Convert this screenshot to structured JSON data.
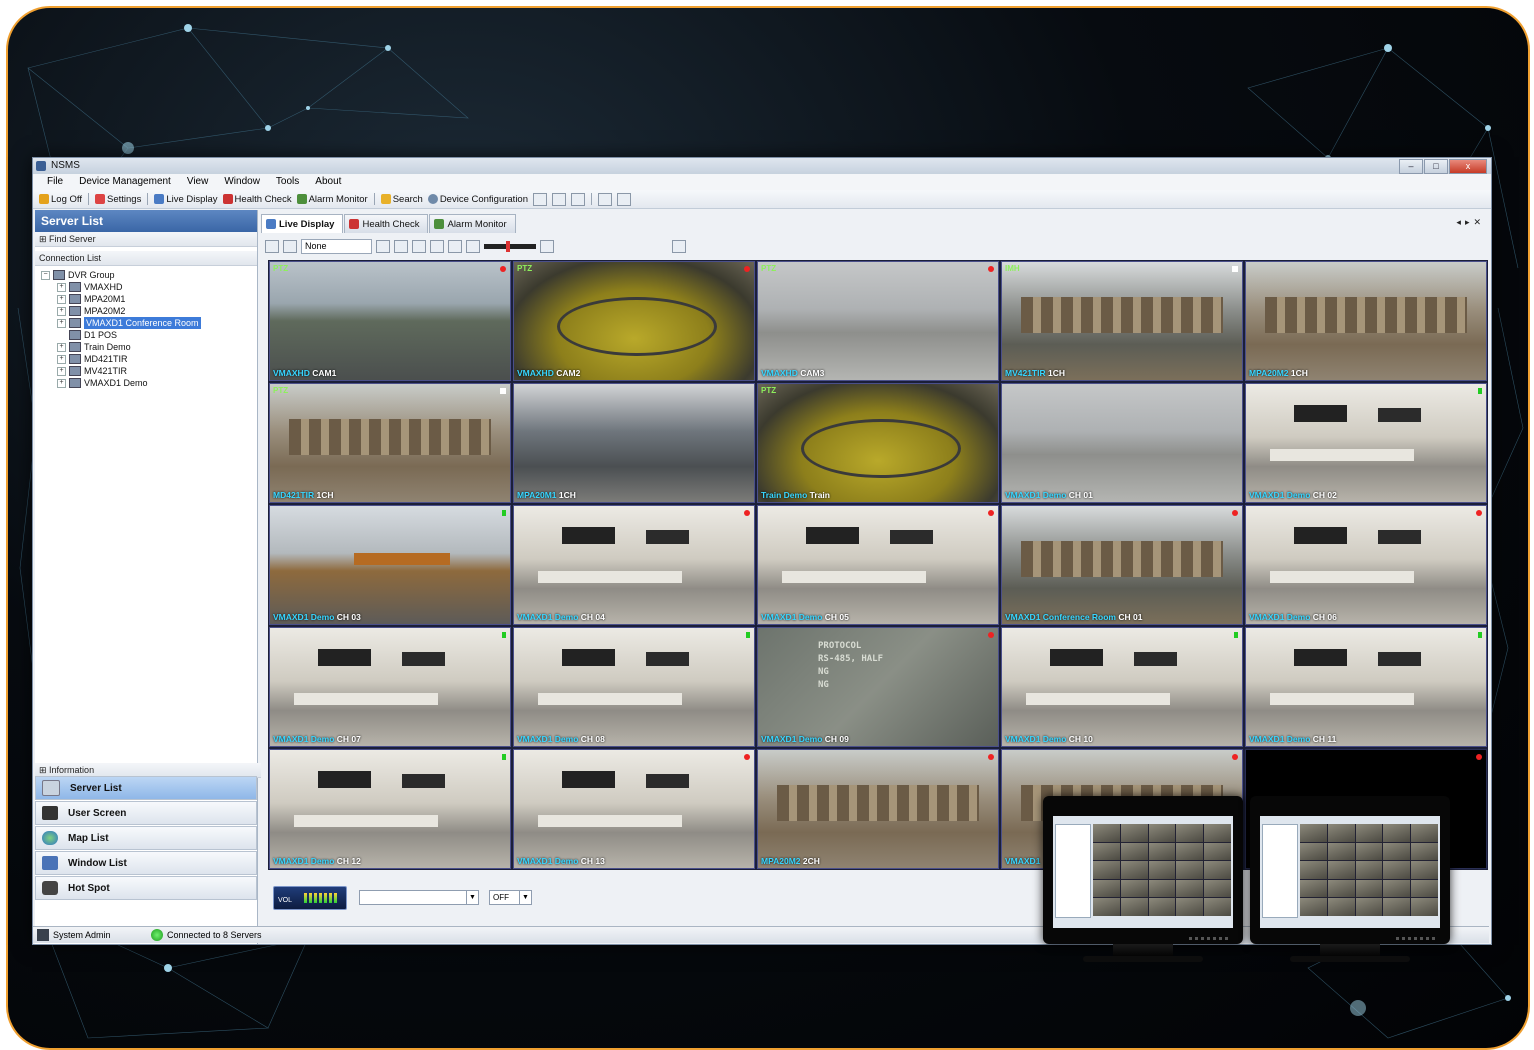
{
  "window": {
    "title": "NSMS",
    "buttons": [
      "–",
      "□",
      "x"
    ]
  },
  "menu": [
    "File",
    "Device Management",
    "View",
    "Window",
    "Tools",
    "About"
  ],
  "toolbar": {
    "logoff": "Log Off",
    "settings": "Settings",
    "live_display": "Live Display",
    "health_check": "Health Check",
    "alarm_monitor": "Alarm Monitor",
    "search": "Search",
    "device_configuration": "Device Configuration"
  },
  "left_pane": {
    "title": "Server List",
    "find_server": "Find Server",
    "connection_list": "Connection List",
    "tree": [
      {
        "label": "DVR Group",
        "level": 0,
        "expander": "−"
      },
      {
        "label": "VMAXHD",
        "level": 1,
        "expander": "+"
      },
      {
        "label": "MPA20M1",
        "level": 1,
        "expander": "+"
      },
      {
        "label": "MPA20M2",
        "level": 1,
        "expander": "+"
      },
      {
        "label": "VMAXD1 Conference Room",
        "level": 1,
        "expander": "+",
        "selected": true
      },
      {
        "label": "D1 POS",
        "level": 1,
        "expander": ""
      },
      {
        "label": "Train Demo",
        "level": 1,
        "expander": "+"
      },
      {
        "label": "MD421TIR",
        "level": 1,
        "expander": "+"
      },
      {
        "label": "MV421TIR",
        "level": 1,
        "expander": "+"
      },
      {
        "label": "VMAXD1 Demo",
        "level": 1,
        "expander": "+"
      }
    ],
    "information": "Information",
    "nav": [
      "Server List",
      "User Screen",
      "Map List",
      "Window List",
      "Hot Spot"
    ]
  },
  "tabs": [
    "Live Display",
    "Health Check",
    "Alarm Monitor"
  ],
  "view_toolbar": {
    "sequence": "None"
  },
  "cells": [
    {
      "cap1": "VMAXHD",
      "cap2": "CAM1",
      "ptz": "PTZ",
      "dot": "red",
      "scene": "parking"
    },
    {
      "cap1": "VMAXHD",
      "cap2": "CAM2",
      "ptz": "PTZ",
      "dot": "red",
      "scene": "train"
    },
    {
      "cap1": "VMAXHD",
      "cap2": "CAM3",
      "ptz": "PTZ",
      "dot": "red",
      "scene": "lot"
    },
    {
      "cap1": "MV421TIR",
      "cap2": "1CH",
      "ptz": "IMH",
      "dot": "white",
      "scene": "workshop"
    },
    {
      "cap1": "MPA20M2",
      "cap2": "1CH",
      "ptz": "",
      "dot": "",
      "scene": "warehouse"
    },
    {
      "cap1": "MD421TIR",
      "cap2": "1CH",
      "ptz": "PTZ",
      "dot": "white",
      "scene": "warehouse"
    },
    {
      "cap1": "MPA20M1",
      "cap2": "1CH",
      "ptz": "",
      "dot": "",
      "scene": "lobby"
    },
    {
      "cap1": "Train Demo",
      "cap2": "Train",
      "ptz": "PTZ",
      "dot": "",
      "scene": "train"
    },
    {
      "cap1": "VMAXD1 Demo",
      "cap2": "CH 01",
      "ptz": "",
      "dot": "",
      "scene": "lot"
    },
    {
      "cap1": "VMAXD1 Demo",
      "cap2": "CH 02",
      "ptz": "",
      "dot": "green",
      "scene": "office"
    },
    {
      "cap1": "VMAXD1 Demo",
      "cap2": "CH 03",
      "ptz": "",
      "dot": "green",
      "scene": "trainside"
    },
    {
      "cap1": "VMAXD1 Demo",
      "cap2": "CH 04",
      "ptz": "",
      "dot": "red",
      "scene": "office"
    },
    {
      "cap1": "VMAXD1 Demo",
      "cap2": "CH 05",
      "ptz": "",
      "dot": "red",
      "scene": "office"
    },
    {
      "cap1": "VMAXD1 Conference Room",
      "cap2": "CH 01",
      "ptz": "",
      "dot": "red",
      "scene": "workshop"
    },
    {
      "cap1": "VMAXD1 Demo",
      "cap2": "CH 06",
      "ptz": "",
      "dot": "red",
      "scene": "office"
    },
    {
      "cap1": "VMAXD1 Demo",
      "cap2": "CH 07",
      "ptz": "",
      "dot": "green",
      "scene": "office"
    },
    {
      "cap1": "VMAXD1 Demo",
      "cap2": "CH 08",
      "ptz": "",
      "dot": "green",
      "scene": "office"
    },
    {
      "cap1": "VMAXD1 Demo",
      "cap2": "CH 09",
      "ptz": "",
      "dot": "red",
      "scene": "protocol"
    },
    {
      "cap1": "VMAXD1 Demo",
      "cap2": "CH 10",
      "ptz": "",
      "dot": "green",
      "scene": "office"
    },
    {
      "cap1": "VMAXD1 Demo",
      "cap2": "CH 11",
      "ptz": "",
      "dot": "green",
      "scene": "office"
    },
    {
      "cap1": "VMAXD1 Demo",
      "cap2": "CH 12",
      "ptz": "",
      "dot": "green",
      "scene": "office"
    },
    {
      "cap1": "VMAXD1 Demo",
      "cap2": "CH 13",
      "ptz": "",
      "dot": "red",
      "scene": "office"
    },
    {
      "cap1": "MPA20M2",
      "cap2": "2CH",
      "ptz": "",
      "dot": "red",
      "scene": "warehouse"
    },
    {
      "cap1": "VMAXD1",
      "cap2": "",
      "ptz": "",
      "dot": "red",
      "scene": "warehouse"
    },
    {
      "cap1": "",
      "cap2": "",
      "ptz": "",
      "dot": "red",
      "scene": "blank"
    }
  ],
  "protocol_text": [
    "PROTOCOL",
    "RS-485, HALF",
    "NG",
    "NG"
  ],
  "bottom": {
    "vol": "VOL",
    "off": "OFF"
  },
  "status": {
    "user": "System Admin",
    "connection": "Connected to 8 Servers"
  }
}
